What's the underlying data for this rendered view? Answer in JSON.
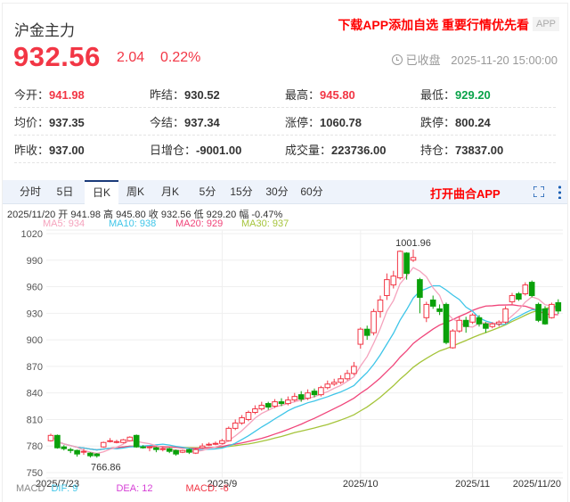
{
  "header": {
    "title": "沪金主力",
    "promo": "下载APP添加自选 重要行情优先看",
    "app_badge": "APP",
    "price": "932.56",
    "change": "2.04",
    "change_pct": "0.22%",
    "status": "已收盘",
    "time": "2025-11-20 15:00:00"
  },
  "stats": [
    [
      {
        "label": "今开：",
        "value": "941.98",
        "color": "red"
      },
      {
        "label": "昨结：",
        "value": "930.52"
      },
      {
        "label": "最高：",
        "value": "945.80",
        "color": "red"
      },
      {
        "label": "最低：",
        "value": "929.20",
        "color": "green"
      }
    ],
    [
      {
        "label": "均价：",
        "value": "937.35"
      },
      {
        "label": "今结：",
        "value": "937.34"
      },
      {
        "label": "涨停：",
        "value": "1060.78"
      },
      {
        "label": "跌停：",
        "value": "800.24"
      }
    ],
    [
      {
        "label": "昨收：",
        "value": "937.00"
      },
      {
        "label": "日增仓：",
        "value": "-9001.00"
      },
      {
        "label": "成交量：",
        "value": "223736.00"
      },
      {
        "label": "持仓：",
        "value": "73837.00"
      }
    ]
  ],
  "tabs": [
    "分时",
    "5日",
    "日K",
    "周K",
    "月K",
    "5分",
    "15分",
    "30分",
    "60分"
  ],
  "active_tab": "日K",
  "open_app": "打开曲合APP",
  "info_line": "2025/11/20 开 941.98 高 945.80 收 932.56 低 929.20 幅 -0.47%",
  "ma": {
    "ma5": "MA5: 934",
    "ma10": "MA10: 938",
    "ma20": "MA20: 929",
    "ma30": "MA30: 937"
  },
  "macd": {
    "label": "MACD",
    "dif": "DIF: 9",
    "dea": "DEA: 12",
    "macd": "MACD: -6"
  },
  "colors": {
    "up": "#f23645",
    "down": "#0aa10a",
    "ma5": "#f5a3bd",
    "ma10": "#3ec5e8",
    "ma20": "#f0457a",
    "ma30": "#a5c43a"
  },
  "chart_data": {
    "type": "candlestick",
    "y_ticks": [
      1020,
      990,
      960,
      930,
      900,
      870,
      840,
      810,
      780,
      750
    ],
    "ylim": [
      750,
      1020
    ],
    "x_labels": [
      "2025/7/23",
      "2025/9",
      "2025/10",
      "2025/11",
      "2025/11/20"
    ],
    "x_label_index": [
      0,
      26,
      47,
      64,
      77
    ],
    "annotations": {
      "high": "1001.96",
      "low": "766.86",
      "high_index": 55,
      "low_index": 7
    },
    "candles_ohlc": [
      [
        786,
        792,
        794,
        785
      ],
      [
        792,
        778,
        793,
        777
      ],
      [
        779,
        777,
        781,
        775
      ],
      [
        776,
        775,
        778,
        772
      ],
      [
        775,
        771,
        776,
        768
      ],
      [
        774,
        774,
        777,
        770
      ],
      [
        772,
        769,
        773,
        767
      ],
      [
        771,
        769,
        772,
        766.86
      ],
      [
        779,
        784,
        785,
        778
      ],
      [
        786,
        786,
        789,
        784
      ],
      [
        785,
        785,
        787,
        783
      ],
      [
        784,
        787,
        788,
        783
      ],
      [
        786,
        790,
        791,
        785
      ],
      [
        792,
        779,
        793,
        778
      ],
      [
        779,
        778,
        781,
        777
      ],
      [
        779,
        779,
        780,
        774
      ],
      [
        778,
        776,
        779,
        773
      ],
      [
        777,
        777,
        779,
        774
      ],
      [
        777,
        774,
        778,
        772
      ],
      [
        775,
        771,
        776,
        769
      ],
      [
        773,
        775,
        776,
        772
      ],
      [
        776,
        773,
        777,
        771
      ],
      [
        772,
        776,
        778,
        771
      ],
      [
        778,
        780,
        783,
        777
      ],
      [
        781,
        782,
        784,
        780
      ],
      [
        782,
        783,
        785,
        781
      ],
      [
        783,
        786,
        788,
        782
      ],
      [
        786,
        800,
        802,
        785
      ],
      [
        800,
        806,
        810,
        798
      ],
      [
        806,
        812,
        815,
        804
      ],
      [
        810,
        818,
        820,
        808
      ],
      [
        818,
        822,
        826,
        816
      ],
      [
        822,
        826,
        830,
        820
      ],
      [
        828,
        824,
        830,
        821
      ],
      [
        825,
        830,
        833,
        823
      ],
      [
        830,
        828,
        834,
        825
      ],
      [
        828,
        832,
        836,
        826
      ],
      [
        832,
        836,
        840,
        830
      ],
      [
        838,
        833,
        842,
        830
      ],
      [
        834,
        840,
        844,
        832
      ],
      [
        842,
        838,
        845,
        835
      ],
      [
        838,
        846,
        848,
        836
      ],
      [
        846,
        850,
        854,
        844
      ],
      [
        850,
        852,
        856,
        848
      ],
      [
        852,
        856,
        860,
        850
      ],
      [
        856,
        862,
        866,
        854
      ],
      [
        862,
        870,
        875,
        860
      ],
      [
        895,
        912,
        914,
        890
      ],
      [
        912,
        905,
        916,
        900
      ],
      [
        908,
        932,
        935,
        905
      ],
      [
        932,
        945,
        950,
        925
      ],
      [
        950,
        968,
        975,
        945
      ],
      [
        962,
        972,
        978,
        958
      ],
      [
        970,
        1000,
        1001,
        968
      ],
      [
        998,
        975,
        999,
        968
      ],
      [
        990,
        993,
        1001.96,
        988
      ],
      [
        968,
        948,
        970,
        930
      ],
      [
        925,
        940,
        943,
        920
      ],
      [
        945,
        938,
        950,
        935
      ],
      [
        935,
        932,
        940,
        928
      ],
      [
        940,
        897,
        942,
        895
      ],
      [
        891,
        910,
        912,
        890
      ],
      [
        910,
        922,
        926,
        908
      ],
      [
        922,
        915,
        926,
        908
      ],
      [
        920,
        928,
        930,
        918
      ],
      [
        925,
        918,
        928,
        915
      ],
      [
        918,
        913,
        920,
        908
      ],
      [
        915,
        918,
        920,
        913
      ],
      [
        918,
        920,
        922,
        915
      ],
      [
        920,
        935,
        938,
        918
      ],
      [
        943,
        950,
        953,
        940
      ],
      [
        952,
        946,
        954,
        944
      ],
      [
        952,
        962,
        965,
        950
      ],
      [
        965,
        950,
        967,
        948
      ],
      [
        940,
        922,
        942,
        920
      ],
      [
        935,
        918,
        938,
        917
      ],
      [
        925,
        940,
        942,
        924
      ],
      [
        941.98,
        932.56,
        945.8,
        929.2
      ]
    ]
  }
}
